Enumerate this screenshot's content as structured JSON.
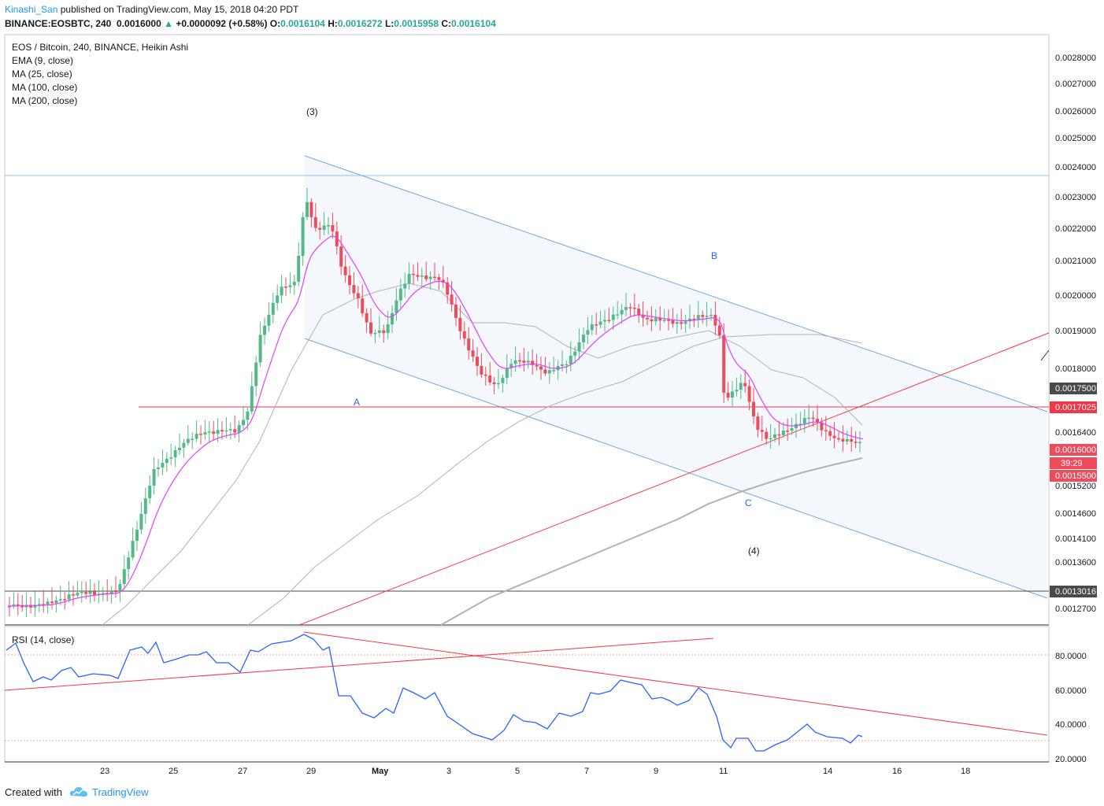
{
  "header": {
    "author": "Kinashi_San",
    "published_text": "published on TradingView.com, May 15, 2018 04:20 PDT",
    "symbol_line": "BINANCE:EOSBTC, 240",
    "last": "0.0016000",
    "change": "+0.0000092 (+0.58%)",
    "o_label": "O:",
    "o": "0.0016104",
    "h_label": "H:",
    "h": "0.0016272",
    "l_label": "L:",
    "l": "0.0015958",
    "c_label": "C:",
    "c": "0.0016104"
  },
  "legend": {
    "title": "EOS / Bitcoin, 240, BINANCE, Heikin Ashi",
    "indicators": [
      "EMA (9, close)",
      "MA (25, close)",
      "MA (100, close)",
      "MA (200, close)"
    ],
    "rsi": "RSI (14, close)"
  },
  "annotations": {
    "wave3": "(3)",
    "wave4": "(4)",
    "A": "A",
    "B": "B",
    "C": "C"
  },
  "price_axis": {
    "ticks": [
      "0.0028000",
      "0.0027000",
      "0.0026000",
      "0.0025000",
      "0.0024000",
      "0.0023000",
      "0.0022000",
      "0.0021000",
      "0.0020000",
      "0.0019000",
      "0.0018000",
      "0.0016400",
      "0.0015200",
      "0.0014600",
      "0.0014100",
      "0.0013600",
      "0.0012700"
    ],
    "tag_1750": "0.0017500",
    "tag_17025": "0.0017025",
    "tag_last": "0.0016000",
    "tag_timer": "39:29",
    "tag_1550": "0.0015500",
    "tag_13016": "0.0013016"
  },
  "rsi_axis": {
    "ticks": [
      "80.0000",
      "60.0000",
      "40.0000",
      "20.0000"
    ]
  },
  "time_axis": {
    "labels": [
      "23",
      "25",
      "27",
      "29",
      "May",
      "3",
      "5",
      "7",
      "9",
      "11",
      "14",
      "16",
      "18"
    ]
  },
  "colors": {
    "up": "#53b987",
    "down": "#eb4d5c",
    "ema": "#e040fb",
    "ma": "#b2b2b2",
    "channel": "#6fa8dc",
    "red_line": "#f23645",
    "rsi": "#2962ff",
    "tag_dark": "#4a4a4a"
  },
  "chart_data": {
    "type": "candlestick",
    "symbol": "EOS / Bitcoin",
    "interval": "240",
    "exchange": "BINANCE",
    "style": "Heikin Ashi",
    "date_range": [
      "2018-04-21",
      "2018-05-15"
    ],
    "key_points": [
      {
        "label": "(3)",
        "date": "2018-04-28",
        "price": 0.00244
      },
      {
        "label": "B",
        "date": "2018-05-10",
        "price": 0.002
      },
      {
        "label": "C",
        "date": "2018-05-12",
        "price": 0.00152
      }
    ],
    "horizontal_levels": [
      0.0024,
      0.0017025,
      0.0013016
    ],
    "last_price": 0.0016,
    "rsi": {
      "period": 14,
      "levels": [
        30,
        70
      ],
      "points": [
        [
          "2018-04-21",
          84
        ],
        [
          "2018-04-22",
          66
        ],
        [
          "2018-04-23",
          69
        ],
        [
          "2018-04-24",
          82
        ],
        [
          "2018-04-25",
          76
        ],
        [
          "2018-04-26",
          79
        ],
        [
          "2018-04-27",
          76
        ],
        [
          "2018-04-28",
          88
        ],
        [
          "2018-04-29",
          72
        ],
        [
          "2018-04-30",
          52
        ],
        [
          "2018-05-01",
          47
        ],
        [
          "2018-05-02",
          61
        ],
        [
          "2018-05-03",
          54
        ],
        [
          "2018-05-04",
          34
        ],
        [
          "2018-05-05",
          44
        ],
        [
          "2018-05-06",
          40
        ],
        [
          "2018-05-07",
          50
        ],
        [
          "2018-05-08",
          65
        ],
        [
          "2018-05-09",
          58
        ],
        [
          "2018-05-10",
          61
        ],
        [
          "2018-05-11",
          30
        ],
        [
          "2018-05-12",
          24
        ],
        [
          "2018-05-13",
          34
        ],
        [
          "2018-05-14",
          31
        ],
        [
          "2018-05-15",
          33
        ]
      ]
    }
  }
}
